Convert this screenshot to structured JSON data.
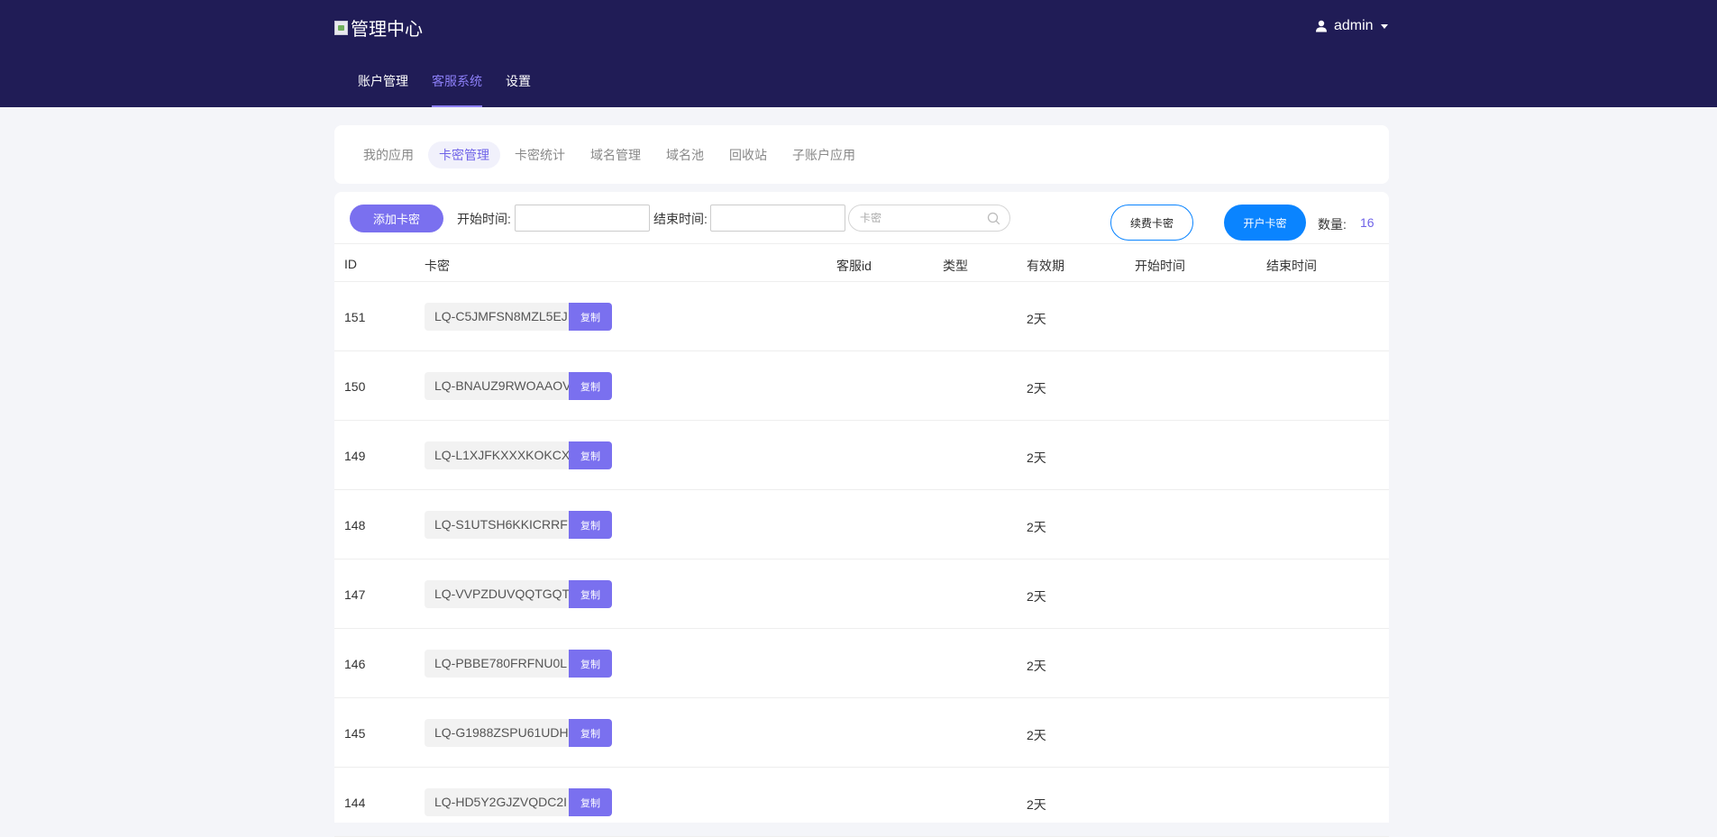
{
  "header": {
    "title": "管理中心",
    "user": "admin",
    "nav": [
      {
        "label": "账户管理",
        "active": false
      },
      {
        "label": "客服系统",
        "active": true
      },
      {
        "label": "设置",
        "active": false
      }
    ]
  },
  "subtabs": [
    {
      "label": "我的应用",
      "active": false
    },
    {
      "label": "卡密管理",
      "active": true
    },
    {
      "label": "卡密统计",
      "active": false
    },
    {
      "label": "域名管理",
      "active": false
    },
    {
      "label": "域名池",
      "active": false
    },
    {
      "label": "回收站",
      "active": false
    },
    {
      "label": "子账户应用",
      "active": false
    }
  ],
  "toolbar": {
    "add_label": "添加卡密",
    "start_label": "开始时间:",
    "end_label": "结束时间:",
    "search_placeholder": "卡密",
    "renew_label": "续费卡密",
    "open_label": "开户卡密",
    "count_label": "数量:",
    "count_value": "16"
  },
  "table": {
    "columns": [
      "ID",
      "卡密",
      "客服id",
      "类型",
      "有效期",
      "开始时间",
      "结束时间"
    ],
    "copy_label": "复制",
    "rows": [
      {
        "id": "151",
        "key": "LQ-C5JMFSN8MZL5EJ",
        "days": "2天"
      },
      {
        "id": "150",
        "key": "LQ-BNAUZ9RWOAAOV",
        "days": "2天"
      },
      {
        "id": "149",
        "key": "LQ-L1XJFKXXXKOKCX",
        "days": "2天"
      },
      {
        "id": "148",
        "key": "LQ-S1UTSH6KKICRRF",
        "days": "2天"
      },
      {
        "id": "147",
        "key": "LQ-VVPZDUVQQTGQT",
        "days": "2天"
      },
      {
        "id": "146",
        "key": "LQ-PBBE780FRFNU0L",
        "days": "2天"
      },
      {
        "id": "145",
        "key": "LQ-G1988ZSPU61UDH",
        "days": "2天"
      },
      {
        "id": "144",
        "key": "LQ-HD5Y2GJZVQDC2I",
        "days": "2天"
      }
    ]
  },
  "colors": {
    "header_bg": "#201c56",
    "accent": "#7a70ef",
    "blue": "#0a84ff"
  }
}
